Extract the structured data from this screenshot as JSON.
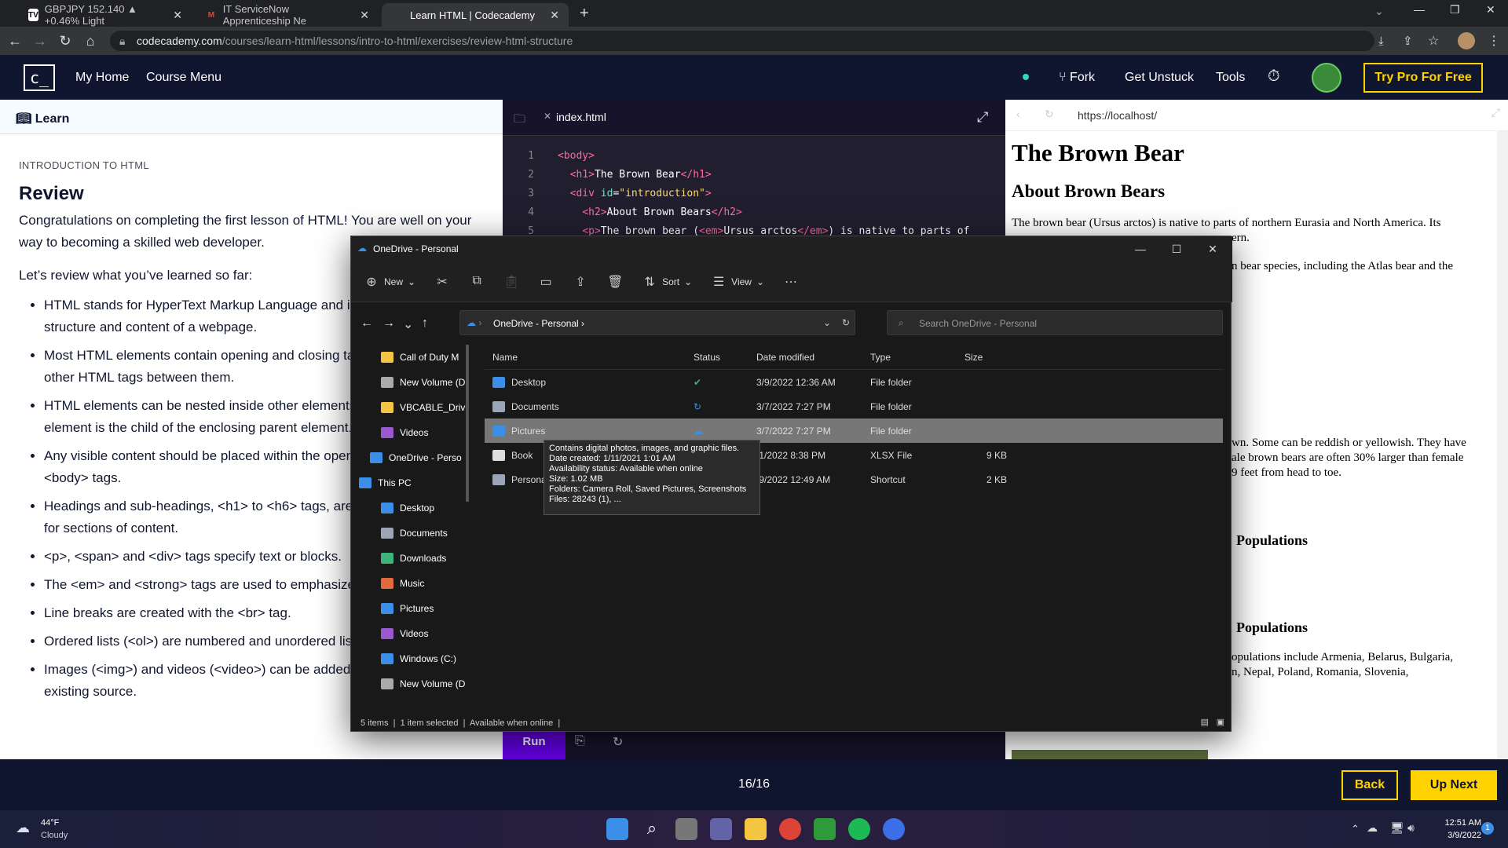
{
  "browser": {
    "tabs": [
      {
        "label": "GBPJPY 152.140 ▲ +0.46% Light",
        "favicon": "TV"
      },
      {
        "label": "IT ServiceNow Apprenticeship Ne",
        "favicon": "M"
      },
      {
        "label": "Learn HTML | Codecademy",
        "favicon": ""
      }
    ],
    "url_host": "codecademy.com",
    "url_path": "/courses/learn-html/lessons/intro-to-html/exercises/review-html-structure"
  },
  "header": {
    "logo": "c_",
    "nav": [
      "My Home",
      "Course Menu"
    ],
    "fork": "Fork",
    "get_unstuck": "Get Unstuck",
    "tools": "Tools",
    "try_pro": "Try Pro For Free"
  },
  "lesson": {
    "learn_label": "Learn",
    "kicker": "INTRODUCTION TO HTML",
    "title": "Review",
    "intro": "Congratulations on completing the first lesson of HTML! You are well on your way to becoming a skilled web developer.",
    "review_lead": "Let’s review what you’ve learned so far:",
    "bullets": [
      "HTML stands for HyperText Markup Language and is used to create the structure and content of a webpage.",
      "Most HTML elements contain opening and closing tags with raw text or other HTML tags between them.",
      "HTML elements can be nested inside other elements. The enclosed element is the child of the enclosing parent element.",
      "Any visible content should be placed within the opening and closing <body> tags.",
      "Headings and sub-headings, <h1> to <h6> tags, are used to provide titles for sections of content.",
      "<p>, <span> and <div> tags specify text or blocks.",
      "The <em> and <strong> tags are used to emphasize text.",
      "Line breaks are created with the <br> tag.",
      "Ordered lists (<ol>) are numbered and unordered lists (<ul>) are bulleted.",
      "Images (<img>) and videos (<video>) can be added by linking to an existing source."
    ]
  },
  "editor": {
    "file": "index.html",
    "lines": [
      {
        "n": "1",
        "html": "<span class='tg'>&lt;body&gt;</span>"
      },
      {
        "n": "2",
        "html": "&nbsp;&nbsp;<span class='tg'>&lt;h1&gt;</span>The Brown Bear<span class='tg'>&lt;/h1&gt;</span>"
      },
      {
        "n": "3",
        "html": "&nbsp;&nbsp;<span class='tg'>&lt;div</span> <span class='at'>id</span>=<span class='st'>\"introduction\"</span><span class='tg'>&gt;</span>"
      },
      {
        "n": "4",
        "html": "&nbsp;&nbsp;&nbsp;&nbsp;<span class='tg'>&lt;h2&gt;</span>About Brown Bears<span class='tg'>&lt;/h2&gt;</span>"
      },
      {
        "n": "5",
        "html": "&nbsp;&nbsp;&nbsp;&nbsp;<span class='tg'>&lt;p&gt;</span>The brown bear (<span class='tg'>&lt;em&gt;</span>Ursus arctos<span class='tg'>&lt;/em&gt;</span>) is native to parts of"
      }
    ],
    "run": "Run"
  },
  "preview": {
    "url": "https://localhost/",
    "h1": "The Brown Bear",
    "h2": "About Brown Bears",
    "p1": "The brown bear (Ursus arctos) is native to parts of northern Eurasia and North America. Its",
    "p1b": "ern.",
    "p2": "n bear species, including the Atlas bear and the",
    "p3a": "wn. Some can be reddish or yellowish. They have",
    "p3b": "ale brown bears are often 30% larger than female",
    "p3c": "9 feet from head to toe.",
    "h3a": "Populations",
    "h3b": "Populations",
    "p4a": "opulations include Armenia, Belarus, Bulgaria,",
    "p4b": "n, Nepal, Poland, Romania, Slovenia,"
  },
  "footer": {
    "progress": "16/16",
    "back": "Back",
    "next": "Up Next"
  },
  "explorer": {
    "title": "OneDrive - Personal",
    "cmd": {
      "new": "New",
      "sort": "Sort",
      "view": "View"
    },
    "breadcrumb": "OneDrive - Personal",
    "search_placeholder": "Search OneDrive - Personal",
    "sidebar": [
      {
        "label": "Call of Duty  M",
        "color": "#f4c542",
        "indent": 0
      },
      {
        "label": "New Volume (D",
        "color": "#aaaaaa",
        "indent": 0
      },
      {
        "label": "VBCABLE_Drive",
        "color": "#f4c542",
        "indent": 0
      },
      {
        "label": "Videos",
        "color": "#9b59d0",
        "indent": 0
      },
      {
        "label": "OneDrive - Perso",
        "color": "#3b8fe8",
        "indent": -1
      },
      {
        "label": "This PC",
        "color": "#3b8fe8",
        "indent": -2
      },
      {
        "label": "Desktop",
        "color": "#3b8fe8",
        "indent": 0
      },
      {
        "label": "Documents",
        "color": "#9aa6b8",
        "indent": 0
      },
      {
        "label": "Downloads",
        "color": "#3bb37a",
        "indent": 0
      },
      {
        "label": "Music",
        "color": "#e06a3b",
        "indent": 0
      },
      {
        "label": "Pictures",
        "color": "#3b8fe8",
        "indent": 0
      },
      {
        "label": "Videos",
        "color": "#9b59d0",
        "indent": 0
      },
      {
        "label": "Windows (C:)",
        "color": "#3b8fe8",
        "indent": 0
      },
      {
        "label": "New Volume (D",
        "color": "#aaaaaa",
        "indent": 0
      }
    ],
    "columns": [
      "Name",
      "Status",
      "Date modified",
      "Type",
      "Size"
    ],
    "files": [
      {
        "name": "Desktop",
        "status": "✔",
        "date": "3/9/2022 12:36 AM",
        "type": "File folder",
        "size": "",
        "color": "#3b8fe8"
      },
      {
        "name": "Documents",
        "status": "↻",
        "date": "3/7/2022 7:27 PM",
        "type": "File folder",
        "size": "",
        "color": "#9aa6b8"
      },
      {
        "name": "Pictures",
        "status": "☁",
        "date": "3/7/2022 7:27 PM",
        "type": "File folder",
        "size": "",
        "color": "#3b8fe8"
      },
      {
        "name": "Book",
        "status": "",
        "date": "/1/2022 8:38 PM",
        "type": "XLSX File",
        "size": "9 KB",
        "color": "#dddddd"
      },
      {
        "name": "Personal",
        "status": "",
        "date": "/9/2022 12:49 AM",
        "type": "Shortcut",
        "size": "2 KB",
        "color": "#9aa6b8"
      }
    ],
    "tooltip": [
      "Contains digital photos, images, and graphic files.",
      "Date created: 1/11/2021 1:01 AM",
      "Availability status: Available when online",
      "Size: 1.02 MB",
      "Folders: Camera Roll, Saved Pictures, Screenshots",
      "Files: 28243 (1), ..."
    ],
    "status": {
      "items": "5 items",
      "selected": "1 item selected",
      "avail": "Available when online"
    }
  },
  "taskbar": {
    "temp": "44°F",
    "weather": "Cloudy",
    "time": "12:51 AM",
    "date": "3/9/2022",
    "notif": "1"
  }
}
